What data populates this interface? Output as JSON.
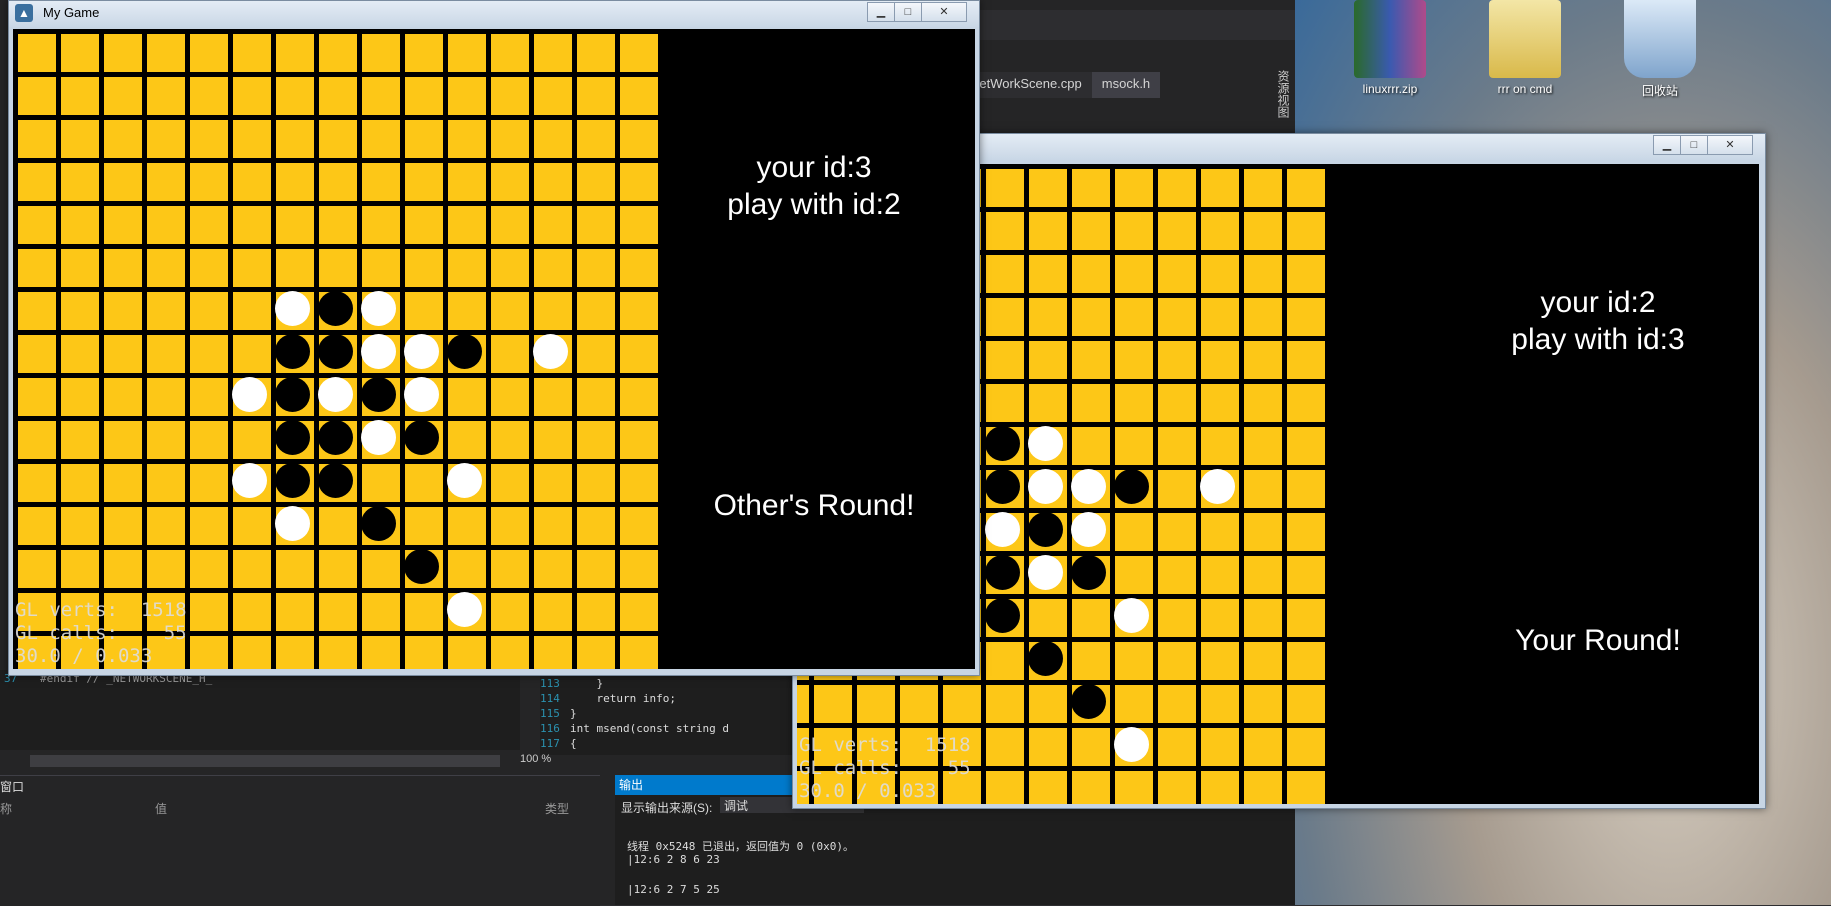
{
  "ide": {
    "tabs": [
      "NetWorkScene.cpp",
      "msock.h"
    ],
    "side_label": "资源视图",
    "code_left": {
      "line": "37",
      "text": "#endif // _NETWORKSCENE_H_"
    },
    "code_right": [
      {
        "n": "113",
        "text": "    }"
      },
      {
        "n": "114",
        "text": "    return info;"
      },
      {
        "n": "115",
        "text": "}"
      },
      {
        "n": "116",
        "text": "int msend(const string d"
      },
      {
        "n": "117",
        "text": "{"
      }
    ],
    "zoom": "100 %",
    "panel_left": {
      "title": "窗口",
      "col_name": "称",
      "col_value": "值",
      "col_type": "类型"
    },
    "output": {
      "title": "输出",
      "source_label": "显示输出来源(S):",
      "source_value": "调试",
      "lines": [
        "线程 0x5248 已退出，返回值为 0 (0x0)。",
        "|12:6 2 8 6 23",
        "",
        "|12:6 2 7 5 25"
      ]
    }
  },
  "desktop": {
    "icons": [
      {
        "label": "linuxrrr.zip",
        "icon": "winrar-archive-icon",
        "color": "#4a7a3a"
      },
      {
        "label": "rrr on cmd",
        "icon": "folder-icon",
        "color": "#e8d27a"
      },
      {
        "label": "回收站",
        "icon": "recycle-bin-icon",
        "color": "#9ab8d8"
      }
    ]
  },
  "windows": [
    {
      "title": "My Game",
      "your_id": "your id:3",
      "play_with": "play with id:2",
      "round": "Other's Round!",
      "stats": "GL verts:  1518\nGL calls:    55\n30.0 / 0.033"
    },
    {
      "title": "",
      "your_id": "your id:2",
      "play_with": "play with id:3",
      "round": "Your Round!",
      "stats": "GL verts:  1518\nGL calls:    55\n30.0 / 0.033"
    }
  ],
  "board1": {
    "cols": 15,
    "rows": 15,
    "pieces": [
      [
        6,
        6,
        "w"
      ],
      [
        7,
        6,
        "b"
      ],
      [
        8,
        6,
        "w"
      ],
      [
        6,
        7,
        "b"
      ],
      [
        7,
        7,
        "b"
      ],
      [
        8,
        7,
        "w"
      ],
      [
        9,
        7,
        "w"
      ],
      [
        10,
        7,
        "b"
      ],
      [
        12,
        7,
        "w"
      ],
      [
        5,
        8,
        "w"
      ],
      [
        6,
        8,
        "b"
      ],
      [
        7,
        8,
        "w"
      ],
      [
        8,
        8,
        "b"
      ],
      [
        9,
        8,
        "w"
      ],
      [
        6,
        9,
        "b"
      ],
      [
        7,
        9,
        "b"
      ],
      [
        8,
        9,
        "w"
      ],
      [
        9,
        9,
        "b"
      ],
      [
        5,
        10,
        "w"
      ],
      [
        6,
        10,
        "b"
      ],
      [
        7,
        10,
        "b"
      ],
      [
        10,
        10,
        "w"
      ],
      [
        6,
        11,
        "w"
      ],
      [
        8,
        11,
        "b"
      ],
      [
        9,
        12,
        "b"
      ],
      [
        10,
        13,
        "w"
      ]
    ]
  },
  "board2": {
    "cols": 15,
    "rows": 15,
    "pieces": [
      [
        6,
        6,
        "w"
      ],
      [
        7,
        6,
        "b"
      ],
      [
        8,
        6,
        "w"
      ],
      [
        6,
        7,
        "b"
      ],
      [
        7,
        7,
        "b"
      ],
      [
        8,
        7,
        "w"
      ],
      [
        9,
        7,
        "w"
      ],
      [
        10,
        7,
        "b"
      ],
      [
        12,
        7,
        "w"
      ],
      [
        5,
        8,
        "w"
      ],
      [
        6,
        8,
        "b"
      ],
      [
        7,
        8,
        "w"
      ],
      [
        8,
        8,
        "b"
      ],
      [
        9,
        8,
        "w"
      ],
      [
        6,
        9,
        "b"
      ],
      [
        7,
        9,
        "b"
      ],
      [
        8,
        9,
        "w"
      ],
      [
        9,
        9,
        "b"
      ],
      [
        5,
        10,
        "w"
      ],
      [
        6,
        10,
        "b"
      ],
      [
        7,
        10,
        "b"
      ],
      [
        10,
        10,
        "w"
      ],
      [
        6,
        11,
        "w"
      ],
      [
        8,
        11,
        "b"
      ],
      [
        9,
        12,
        "b"
      ],
      [
        10,
        13,
        "w"
      ]
    ]
  }
}
